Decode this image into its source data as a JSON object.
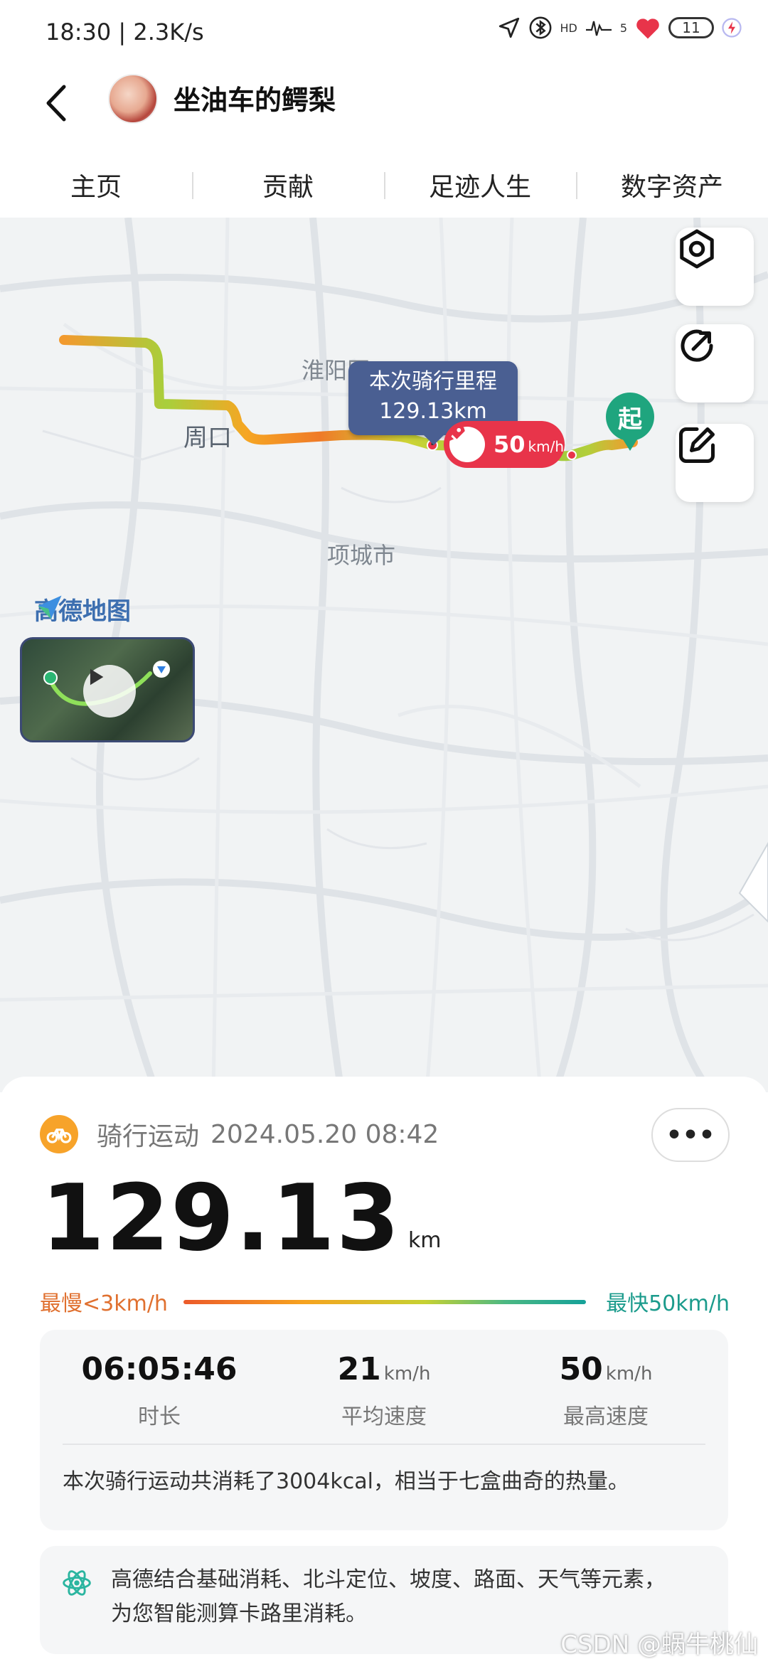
{
  "status_bar": {
    "time_speed": "18:30 | 2.3K/s",
    "battery": "11",
    "network_hd": "HD",
    "signal_num": "5"
  },
  "header": {
    "title": "坐油车的鳄梨"
  },
  "tabs": [
    {
      "label": "主页"
    },
    {
      "label": "贡献"
    },
    {
      "label": "足迹人生"
    },
    {
      "label": "数字资产"
    }
  ],
  "map": {
    "places": {
      "huaiyang": "淮阳区",
      "zhoukou": "周口",
      "xiangcheng": "项城市"
    },
    "callout": {
      "title": "本次骑行里程",
      "value": "129.13km"
    },
    "speed_badge": {
      "value": "50",
      "unit": "km/h"
    },
    "start_label": "起",
    "logo_text": "高德地图",
    "buttons": [
      "settings-icon",
      "share-icon",
      "edit-icon"
    ]
  },
  "activity": {
    "type": "骑行运动",
    "datetime": "2024.05.20 08:42",
    "more": "•••",
    "distance": "129.13",
    "distance_unit": "km",
    "legend": {
      "slow": "最慢<3km/h",
      "fast": "最快50km/h",
      "slow_color": "#e0702f",
      "fast_color": "#1b9b8c"
    },
    "stats": [
      {
        "value": "06:05:46",
        "unit": "",
        "label": "时长"
      },
      {
        "value": "21",
        "unit": "km/h",
        "label": "平均速度"
      },
      {
        "value": "50",
        "unit": "km/h",
        "label": "最高速度"
      }
    ],
    "calorie_text": "本次骑行运动共消耗了3004kcal，相当于七盒曲奇的热量。",
    "info_line1": "高德结合基础消耗、北斗定位、坡度、路面、天气等元素，",
    "info_line2": "为您智能测算卡路里消耗。"
  },
  "watermark": "CSDN @蜗牛桃仙"
}
